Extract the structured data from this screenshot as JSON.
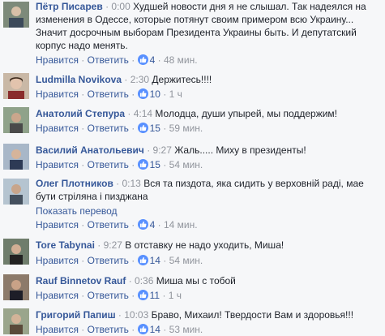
{
  "colors": {
    "link": "#365899",
    "meta": "#90949c",
    "like_badge": "#5890ff",
    "background": "#f6f7f9"
  },
  "labels": {
    "like": "Нравится",
    "reply": "Ответить",
    "dot": "·",
    "show_translation": "Показать перевод"
  },
  "comments": [
    {
      "author": "Пётр Писарев",
      "time": "· 0:00",
      "text": "Худшей новости дня я не слышал. Так надеялся на изменения в Одессе, которые потянут своим примером всю Украину... Значит досрочным выборам Президента Украины быть. И депутатский корпус надо менять.",
      "likes": "4",
      "ago": "48 мин."
    },
    {
      "author": "Ludmilla Novikova",
      "time": "· 2:30",
      "text": "Держитесь!!!!",
      "likes": "10",
      "ago": "1 ч"
    },
    {
      "author": "Анатолий Степура",
      "time": "· 4:14",
      "text": "Молодца, души упырей, мы поддержим!",
      "likes": "15",
      "ago": "59 мин."
    },
    {
      "author": "Василий Анатольевич",
      "time": "· 9:27",
      "text": "Жаль..... Миху в президенты!",
      "likes": "15",
      "ago": "54 мин."
    },
    {
      "author": "Олег Плотников",
      "time": "· 0:13",
      "text": "Вся та пиздота, яка сидить у верховній раді, мае бути стріляна і пизджана",
      "likes": "4",
      "ago": "14 мин."
    },
    {
      "author": "Tore Tabynai",
      "time": "· 9:27",
      "text": "В отставку не надо уходить, Миша!",
      "likes": "14",
      "ago": "54 мин."
    },
    {
      "author": "Rauf Binnetov Rauf",
      "time": "· 0:36",
      "text": "Миша мы с тобой",
      "likes": "11",
      "ago": "1 ч"
    },
    {
      "author": "Григорий Папиш",
      "time": "· 10:03",
      "text": "Браво, Михаил! Твердости Вам и здоровья!!!",
      "likes": "14",
      "ago": "53 мин."
    }
  ]
}
